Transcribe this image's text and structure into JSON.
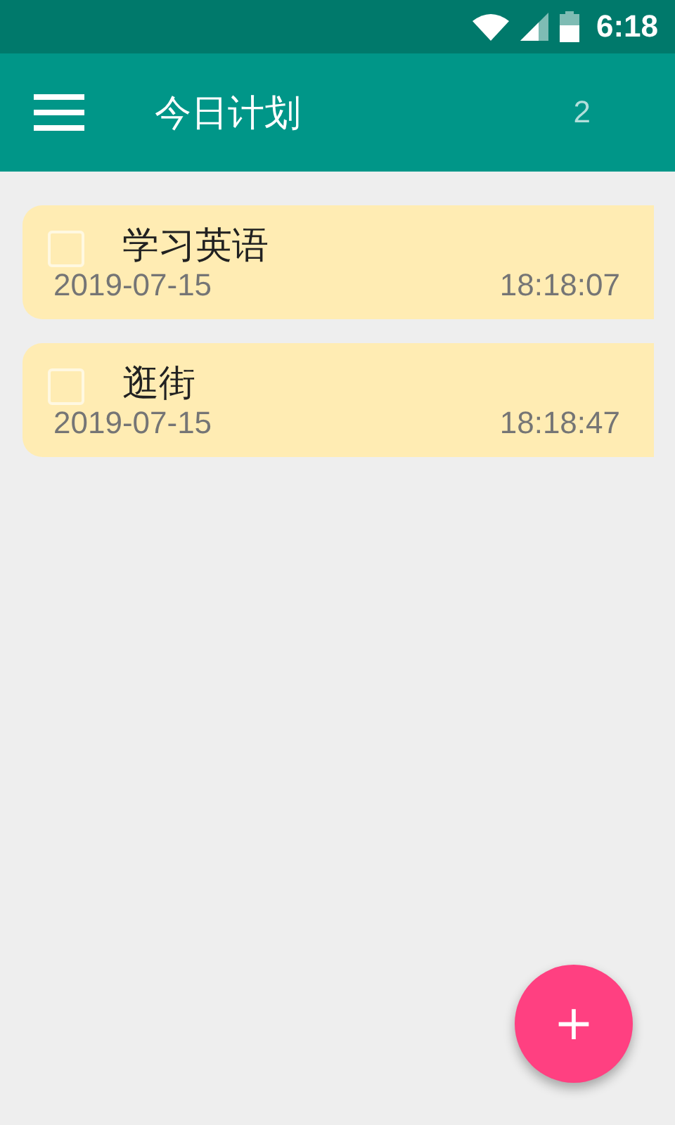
{
  "status_bar": {
    "time": "6:18"
  },
  "toolbar": {
    "title": "今日计划",
    "count": "2"
  },
  "tasks": [
    {
      "title": "学习英语",
      "date": "2019-07-15",
      "time": "18:18:07",
      "checked": false
    },
    {
      "title": "逛街",
      "date": "2019-07-15",
      "time": "18:18:47",
      "checked": false
    }
  ],
  "fab": {
    "label": "+"
  }
}
